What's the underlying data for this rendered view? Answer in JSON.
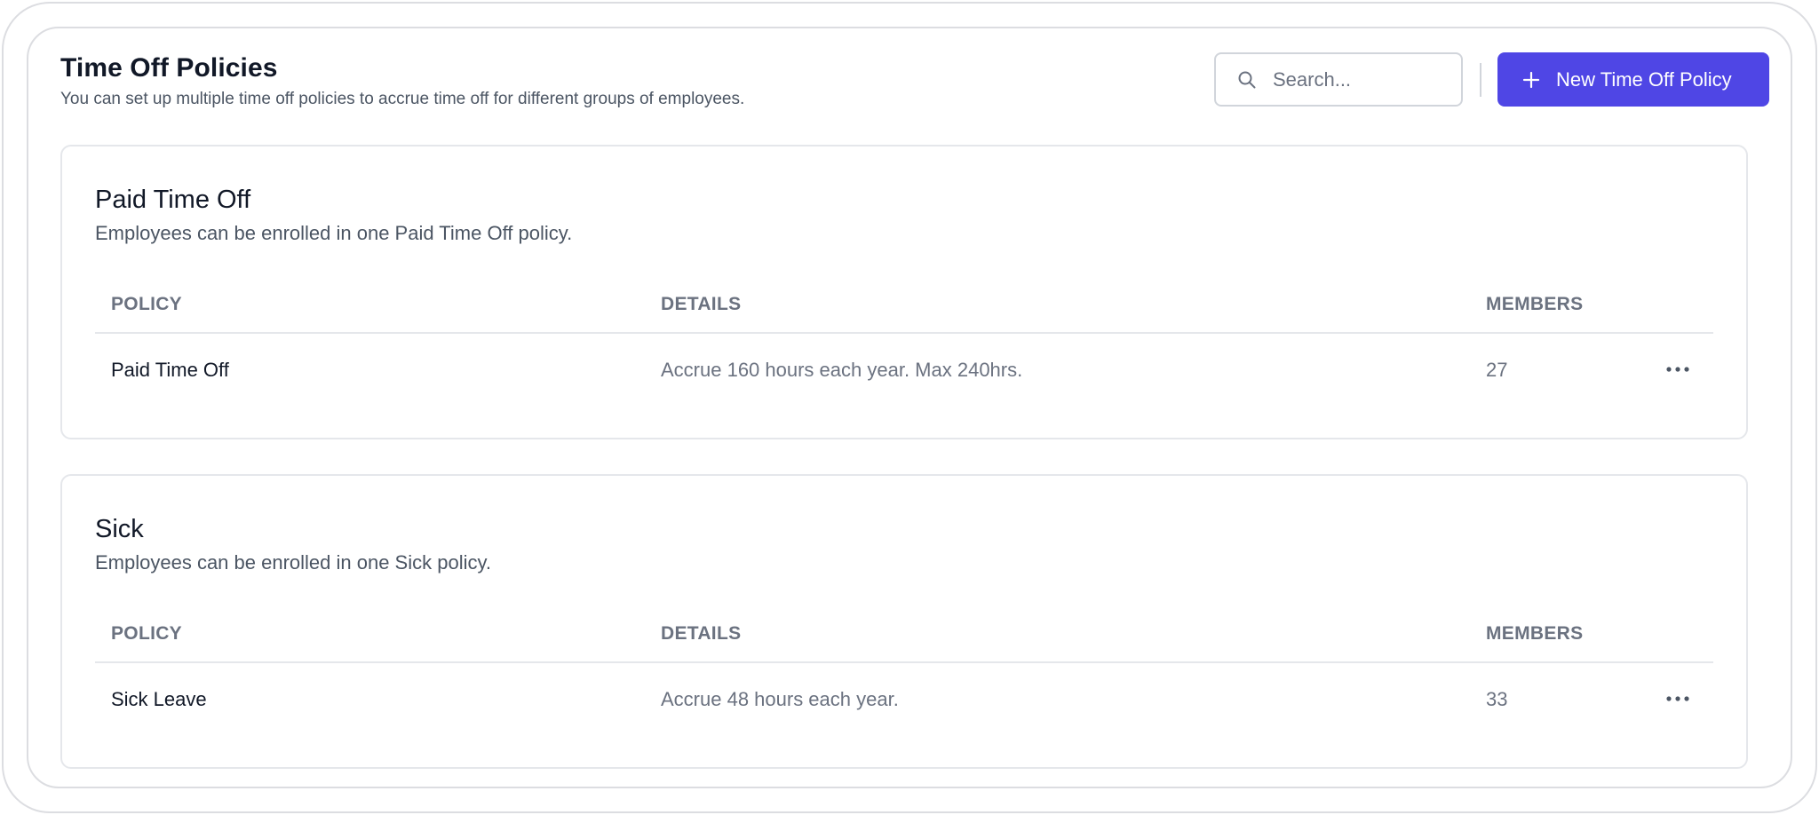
{
  "header": {
    "title": "Time Off Policies",
    "subtitle": "You can set up multiple time off policies to accrue time off for different groups of employees.",
    "search": {
      "placeholder": "Search...",
      "value": "",
      "icon": "search-icon"
    },
    "new_policy_button": {
      "label": "New Time Off Policy",
      "icon": "plus-icon"
    }
  },
  "colors": {
    "accent": "#4f46e5",
    "border": "#e5e7eb",
    "muted_text": "#6b7280"
  },
  "sections": [
    {
      "title": "Paid Time Off",
      "description": "Employees can be enrolled in one Paid Time Off policy.",
      "columns": {
        "policy": "POLICY",
        "details": "DETAILS",
        "members": "MEMBERS"
      },
      "rows": [
        {
          "policy": "Paid Time Off",
          "details": "Accrue 160 hours each year. Max 240hrs.",
          "members": "27",
          "menu_icon": "more-horizontal-icon"
        }
      ]
    },
    {
      "title": "Sick",
      "description": "Employees can be enrolled in one Sick policy.",
      "columns": {
        "policy": "POLICY",
        "details": "DETAILS",
        "members": "MEMBERS"
      },
      "rows": [
        {
          "policy": "Sick Leave",
          "details": "Accrue 48 hours each year.",
          "members": "33",
          "menu_icon": "more-horizontal-icon"
        }
      ]
    }
  ]
}
